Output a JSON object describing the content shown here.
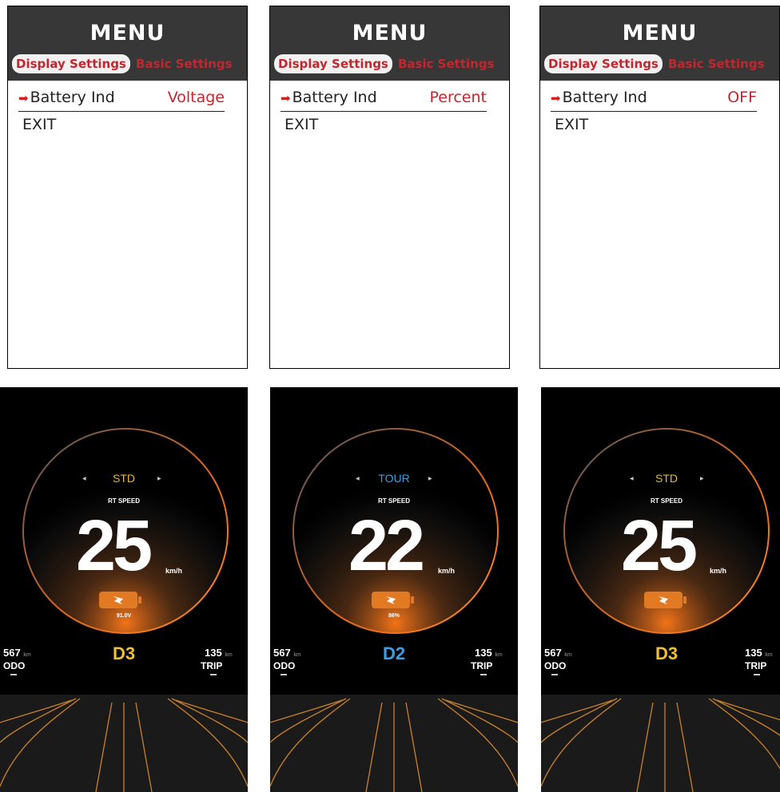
{
  "menus": [
    {
      "title": "MENU",
      "tab_active": "Display Settings",
      "tab_inactive": "Basic Settings",
      "item_label": "Battery Ind",
      "item_value": "Voltage",
      "exit": "EXIT"
    },
    {
      "title": "MENU",
      "tab_active": "Display Settings",
      "tab_inactive": "Basic Settings",
      "item_label": "Battery Ind",
      "item_value": "Percent",
      "exit": "EXIT"
    },
    {
      "title": "MENU",
      "tab_active": "Display Settings",
      "tab_inactive": "Basic Settings",
      "item_label": "Battery Ind",
      "item_value": "OFF",
      "exit": "EXIT"
    }
  ],
  "dashboards": [
    {
      "mode": "STD",
      "mode_color": "#e8b72a",
      "rt_label": "RT SPEED",
      "speed": "25",
      "speed_unit": "km/h",
      "battery_reading": "91.0V",
      "odo_value": "567",
      "odo_unit": "km",
      "odo_label": "ODO",
      "gear": "D3",
      "gear_color": "#f2c12e",
      "trip_value": "135",
      "trip_unit": "km",
      "trip_label": "TRIP"
    },
    {
      "mode": "TOUR",
      "mode_color": "#3b9fe6",
      "rt_label": "RT SPEED",
      "speed": "22",
      "speed_unit": "km/h",
      "battery_reading": "86%",
      "odo_value": "567",
      "odo_unit": "km",
      "odo_label": "ODO",
      "gear": "D2",
      "gear_color": "#3b9fe6",
      "trip_value": "135",
      "trip_unit": "km",
      "trip_label": "TRIP"
    },
    {
      "mode": "STD",
      "mode_color": "#e8b72a",
      "rt_label": "RT SPEED",
      "speed": "25",
      "speed_unit": "km/h",
      "battery_reading": "",
      "odo_value": "567",
      "odo_unit": "km",
      "odo_label": "ODO",
      "gear": "D3",
      "gear_color": "#f2c12e",
      "trip_value": "135",
      "trip_unit": "km",
      "trip_label": "TRIP"
    }
  ],
  "icons": {
    "selector": "right-arrow-icon",
    "battery": "battery-bolt-icon"
  }
}
